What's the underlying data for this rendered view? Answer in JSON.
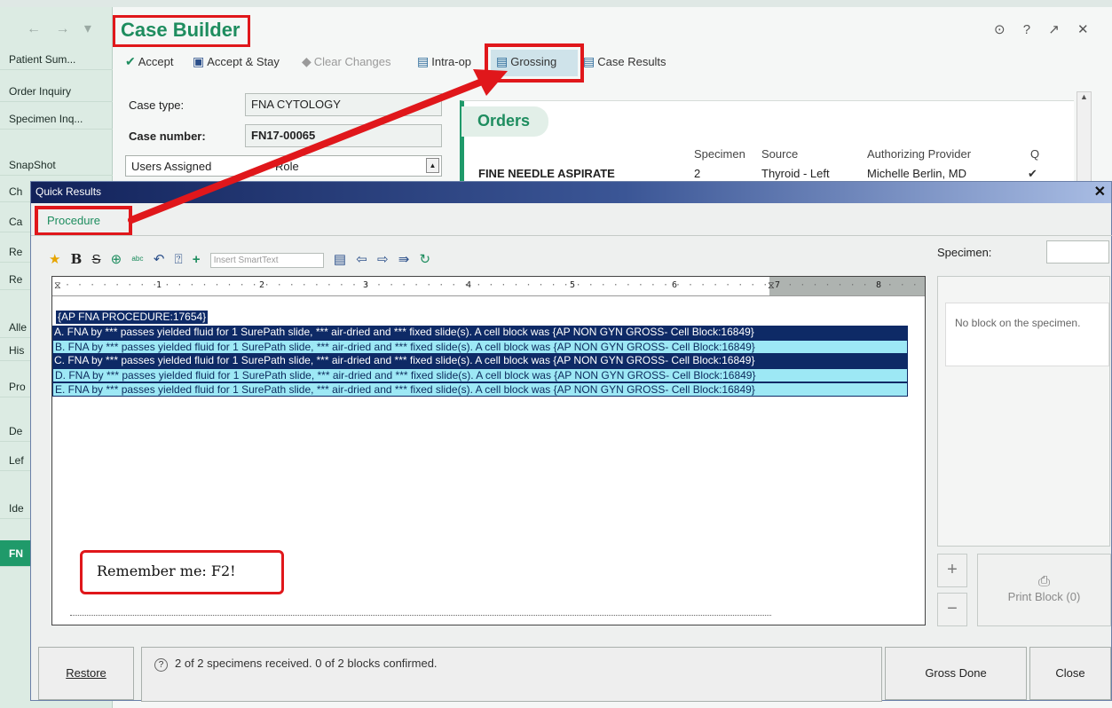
{
  "header": {
    "nav_arrows": "← → ▾",
    "title": "Case Builder",
    "window_icons": "⊙ ? ↗ ✕"
  },
  "sidebar": {
    "items": [
      {
        "label": "Patient Sum..."
      },
      {
        "label": "Order Inquiry"
      },
      {
        "label": "Specimen Inq..."
      },
      {
        "label": "SnapShot"
      },
      {
        "label": "Ch"
      },
      {
        "label": "Ca"
      },
      {
        "label": "Re"
      },
      {
        "label": "Re"
      },
      {
        "label": "Alle"
      },
      {
        "label": "His"
      },
      {
        "label": "Pro"
      },
      {
        "label": "De"
      },
      {
        "label": "Lef"
      },
      {
        "label": "Ide"
      },
      {
        "label": "FN"
      }
    ]
  },
  "toolbar": {
    "accept": "Accept",
    "accept_stay": "Accept & Stay",
    "clear_changes": "Clear Changes",
    "intra_op": "Intra-op",
    "grossing": "Grossing",
    "case_results": "Case Results"
  },
  "form": {
    "case_type_label": "Case type:",
    "case_type_value": "FNA CYTOLOGY",
    "case_number_label": "Case number:",
    "case_number_value": "FN17-00065",
    "users_assigned": "Users Assigned",
    "role": "Role"
  },
  "orders": {
    "title": "Orders",
    "headers": [
      "Specimen",
      "Source",
      "Authorizing Provider",
      "Q"
    ],
    "row": {
      "name": "FINE NEEDLE ASPIRATE",
      "specimen": "2",
      "source": "Thyroid - Left",
      "provider": "Michelle Berlin, MD",
      "q": "✔"
    }
  },
  "dialog": {
    "title": "Quick Results",
    "close": "✕",
    "tab": "Procedure",
    "smarttext_placeholder": "Insert SmartText",
    "procedure_header": "{AP FNA PROCEDURE:17654}",
    "lines": [
      "A. FNA by *** passes yielded fluid for 1 SurePath slide, *** air-dried and *** fixed slide(s). A cell block was {AP NON GYN GROSS- Cell Block:16849}",
      "B.  FNA by *** passes yielded fluid for 1 SurePath slide, *** air-dried and *** fixed slide(s). A cell block was {AP NON GYN GROSS- Cell Block:16849}",
      "C. FNA by *** passes yielded fluid for 1 SurePath slide, *** air-dried and *** fixed slide(s). A cell block was  {AP NON GYN GROSS- Cell Block:16849}",
      "D.  FNA by *** passes yielded fluid for 1 SurePath slide, *** air-dried and *** fixed slide(s). A cell block was  {AP NON GYN GROSS- Cell Block:16849}",
      "E. FNA by *** passes yielded fluid for 1 SurePath slide, *** air-dried and *** fixed slide(s). A cell block was  {AP NON GYN GROSS- Cell Block:16849}"
    ],
    "ruler_numbers": [
      "1",
      "2",
      "3",
      "4",
      "5",
      "6",
      "7",
      "8"
    ],
    "callout": "Remember me: F2!",
    "specimen_label": "Specimen:",
    "no_block": "No block on the specimen.",
    "add": "+",
    "remove": "−",
    "print_block": "Print Block (0)",
    "restore": "Restore",
    "status": "2 of 2 specimens received. 0 of 2 blocks confirmed.",
    "gross_done": "Gross Done",
    "close_btn": "Close"
  },
  "colors": {
    "accent": "#1e8d5f",
    "highlight": "#e0171b",
    "selection_dark": "#0e2a66",
    "selection_light": "#9de8f5"
  }
}
